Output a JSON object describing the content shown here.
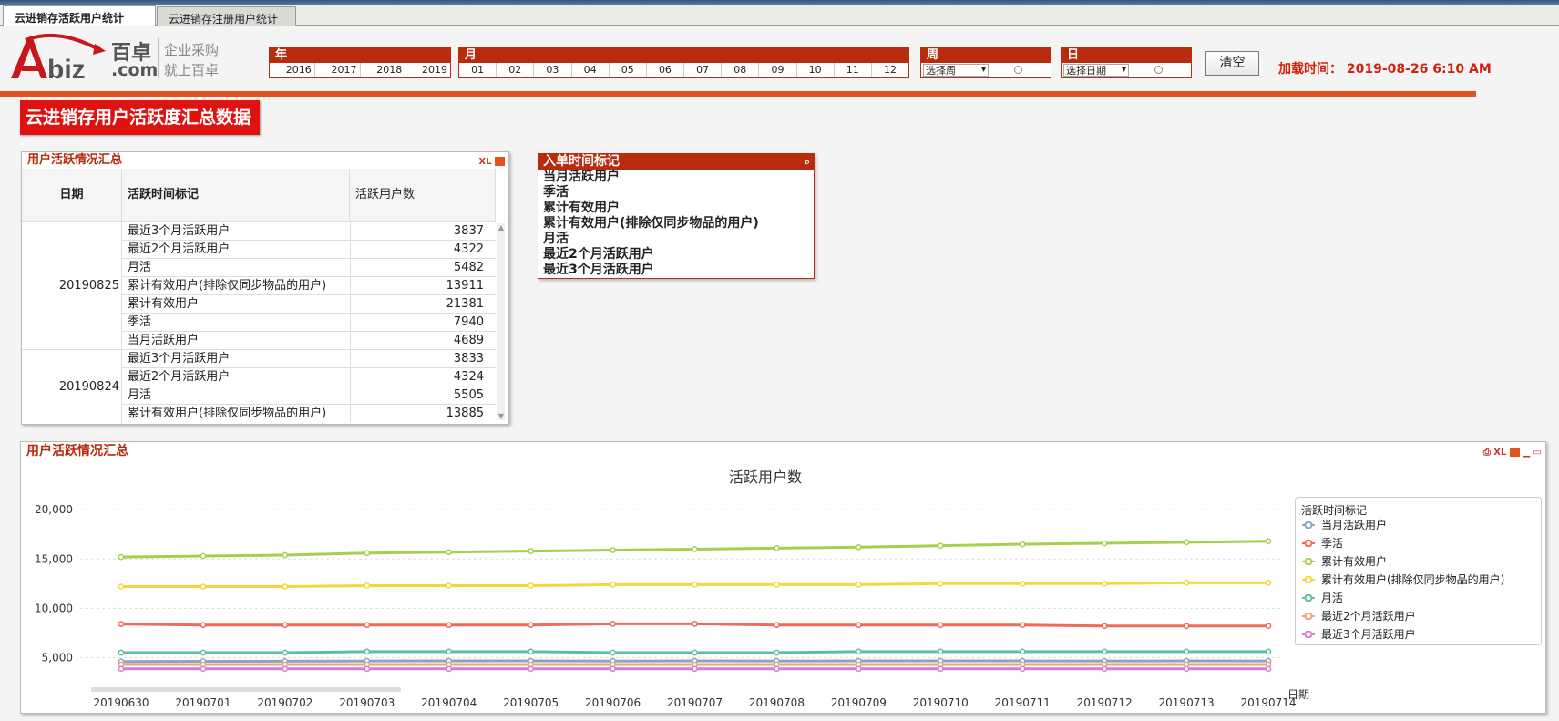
{
  "tabs": [
    {
      "label": "云进销存活跃用户统计",
      "active": true
    },
    {
      "label": "云进销存注册用户统计",
      "active": false
    }
  ],
  "logo": {
    "brand": "百卓",
    "brand_sub": ".com",
    "slogan1": "企业采购",
    "slogan2": "就上百卓"
  },
  "filters": {
    "year": {
      "title": "年",
      "values": [
        "2016",
        "2017",
        "2018",
        "2019"
      ]
    },
    "month": {
      "title": "月",
      "values": [
        "01",
        "02",
        "03",
        "04",
        "05",
        "06",
        "07",
        "08",
        "09",
        "10",
        "11",
        "12"
      ]
    },
    "week": {
      "title": "周",
      "select": "选择周"
    },
    "day": {
      "title": "日",
      "select": "选择日期"
    }
  },
  "clear_label": "清空",
  "load_time": "加载时间： 2019-08-26    6:10 AM",
  "banner": "云进销存用户活跃度汇总数据",
  "table_panel": {
    "title": "用户活跃情况汇总",
    "icons": "XL",
    "headers": [
      "日期",
      "活跃时间标记",
      "活跃用户数"
    ],
    "groups": [
      {
        "date": "20190825",
        "rows": [
          {
            "label": "最近3个月活跃用户",
            "value": "3837"
          },
          {
            "label": "最近2个月活跃用户",
            "value": "4322"
          },
          {
            "label": "月活",
            "value": "5482"
          },
          {
            "label": "累计有效用户(排除仅同步物品的用户)",
            "value": "13911"
          },
          {
            "label": "累计有效用户",
            "value": "21381"
          },
          {
            "label": "季活",
            "value": "7940"
          },
          {
            "label": "当月活跃用户",
            "value": "4689"
          }
        ]
      },
      {
        "date": "20190824",
        "rows": [
          {
            "label": "最近3个月活跃用户",
            "value": "3833"
          },
          {
            "label": "最近2个月活跃用户",
            "value": "4324"
          },
          {
            "label": "月活",
            "value": "5505"
          },
          {
            "label": "累计有效用户(排除仅同步物品的用户)",
            "value": "13885"
          }
        ]
      }
    ]
  },
  "listbox": {
    "title": "入单时间标记",
    "items": [
      "当月活跃用户",
      "季活",
      "累计有效用户",
      "累计有效用户(排除仅同步物品的用户)",
      "月活",
      "最近2个月活跃用户",
      "最近3个月活跃用户"
    ]
  },
  "chart_panel": {
    "title": "用户活跃情况汇总",
    "icons": "XL"
  },
  "chart_data": {
    "type": "line",
    "title": "活跃用户数",
    "xlabel": "日期",
    "ylabel": "",
    "ylim": [
      3000,
      21500
    ],
    "yticks": [
      "5,000",
      "10,000",
      "15,000",
      "20,000"
    ],
    "ytick_values": [
      5000,
      10000,
      15000,
      20000
    ],
    "grid": true,
    "legend_title": "活跃时间标记",
    "legend_position": "right",
    "categories": [
      "20190630",
      "20190701",
      "20190702",
      "20190703",
      "20190704",
      "20190705",
      "20190706",
      "20190707",
      "20190708",
      "20190709",
      "20190710",
      "20190711",
      "20190712",
      "20190713",
      "20190714"
    ],
    "series": [
      {
        "name": "当月活跃用户",
        "color": "#8fa2c6",
        "values": [
          4600,
          4620,
          4630,
          4650,
          4660,
          4660,
          4640,
          4660,
          4650,
          4660,
          4670,
          4660,
          4650,
          4660,
          4650
        ]
      },
      {
        "name": "季活",
        "color": "#f0695a",
        "values": [
          8400,
          8300,
          8300,
          8300,
          8300,
          8300,
          8420,
          8420,
          8300,
          8300,
          8300,
          8300,
          8200,
          8200,
          8200
        ]
      },
      {
        "name": "累计有效用户",
        "color": "#a8cf4c",
        "values": [
          15200,
          15300,
          15400,
          15600,
          15700,
          15800,
          15900,
          16000,
          16100,
          16200,
          16350,
          16500,
          16600,
          16700,
          16800
        ]
      },
      {
        "name": "累计有效用户(排除仅同步物品的用户)",
        "color": "#f4d83a",
        "values": [
          12200,
          12200,
          12200,
          12300,
          12300,
          12300,
          12400,
          12400,
          12400,
          12400,
          12500,
          12500,
          12500,
          12600,
          12600
        ]
      },
      {
        "name": "月活",
        "color": "#5fbf9a",
        "values": [
          5500,
          5500,
          5500,
          5600,
          5600,
          5600,
          5500,
          5500,
          5500,
          5600,
          5600,
          5600,
          5600,
          5600,
          5600
        ]
      },
      {
        "name": "最近2个月活跃用户",
        "color": "#e8a47a",
        "values": [
          4300,
          4300,
          4300,
          4300,
          4300,
          4300,
          4300,
          4300,
          4300,
          4300,
          4300,
          4300,
          4300,
          4300,
          4300
        ]
      },
      {
        "name": "最近3个月活跃用户",
        "color": "#d97ccf",
        "values": [
          3850,
          3850,
          3850,
          3850,
          3850,
          3850,
          3850,
          3850,
          3850,
          3850,
          3850,
          3850,
          3850,
          3850,
          3850
        ]
      }
    ]
  }
}
